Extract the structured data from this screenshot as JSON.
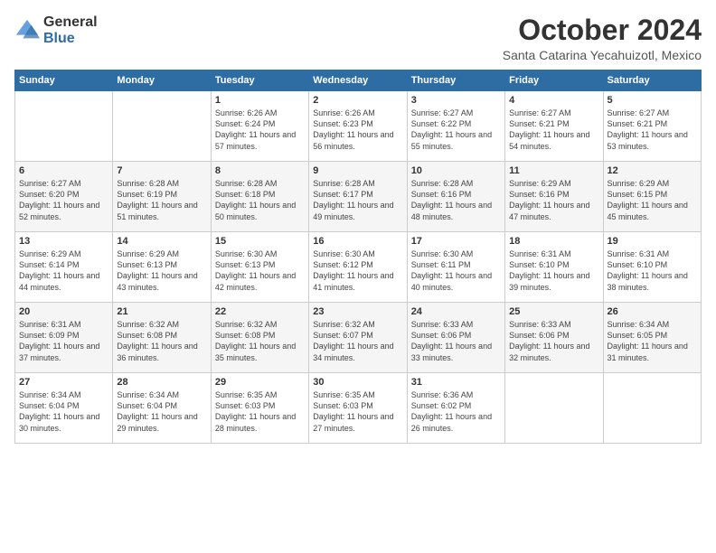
{
  "logo": {
    "general": "General",
    "blue": "Blue"
  },
  "header": {
    "month": "October 2024",
    "location": "Santa Catarina Yecahuizotl, Mexico"
  },
  "weekdays": [
    "Sunday",
    "Monday",
    "Tuesday",
    "Wednesday",
    "Thursday",
    "Friday",
    "Saturday"
  ],
  "weeks": [
    [
      {
        "day": "",
        "info": ""
      },
      {
        "day": "",
        "info": ""
      },
      {
        "day": "1",
        "info": "Sunrise: 6:26 AM\nSunset: 6:24 PM\nDaylight: 11 hours and 57 minutes."
      },
      {
        "day": "2",
        "info": "Sunrise: 6:26 AM\nSunset: 6:23 PM\nDaylight: 11 hours and 56 minutes."
      },
      {
        "day": "3",
        "info": "Sunrise: 6:27 AM\nSunset: 6:22 PM\nDaylight: 11 hours and 55 minutes."
      },
      {
        "day": "4",
        "info": "Sunrise: 6:27 AM\nSunset: 6:21 PM\nDaylight: 11 hours and 54 minutes."
      },
      {
        "day": "5",
        "info": "Sunrise: 6:27 AM\nSunset: 6:21 PM\nDaylight: 11 hours and 53 minutes."
      }
    ],
    [
      {
        "day": "6",
        "info": "Sunrise: 6:27 AM\nSunset: 6:20 PM\nDaylight: 11 hours and 52 minutes."
      },
      {
        "day": "7",
        "info": "Sunrise: 6:28 AM\nSunset: 6:19 PM\nDaylight: 11 hours and 51 minutes."
      },
      {
        "day": "8",
        "info": "Sunrise: 6:28 AM\nSunset: 6:18 PM\nDaylight: 11 hours and 50 minutes."
      },
      {
        "day": "9",
        "info": "Sunrise: 6:28 AM\nSunset: 6:17 PM\nDaylight: 11 hours and 49 minutes."
      },
      {
        "day": "10",
        "info": "Sunrise: 6:28 AM\nSunset: 6:16 PM\nDaylight: 11 hours and 48 minutes."
      },
      {
        "day": "11",
        "info": "Sunrise: 6:29 AM\nSunset: 6:16 PM\nDaylight: 11 hours and 47 minutes."
      },
      {
        "day": "12",
        "info": "Sunrise: 6:29 AM\nSunset: 6:15 PM\nDaylight: 11 hours and 45 minutes."
      }
    ],
    [
      {
        "day": "13",
        "info": "Sunrise: 6:29 AM\nSunset: 6:14 PM\nDaylight: 11 hours and 44 minutes."
      },
      {
        "day": "14",
        "info": "Sunrise: 6:29 AM\nSunset: 6:13 PM\nDaylight: 11 hours and 43 minutes."
      },
      {
        "day": "15",
        "info": "Sunrise: 6:30 AM\nSunset: 6:13 PM\nDaylight: 11 hours and 42 minutes."
      },
      {
        "day": "16",
        "info": "Sunrise: 6:30 AM\nSunset: 6:12 PM\nDaylight: 11 hours and 41 minutes."
      },
      {
        "day": "17",
        "info": "Sunrise: 6:30 AM\nSunset: 6:11 PM\nDaylight: 11 hours and 40 minutes."
      },
      {
        "day": "18",
        "info": "Sunrise: 6:31 AM\nSunset: 6:10 PM\nDaylight: 11 hours and 39 minutes."
      },
      {
        "day": "19",
        "info": "Sunrise: 6:31 AM\nSunset: 6:10 PM\nDaylight: 11 hours and 38 minutes."
      }
    ],
    [
      {
        "day": "20",
        "info": "Sunrise: 6:31 AM\nSunset: 6:09 PM\nDaylight: 11 hours and 37 minutes."
      },
      {
        "day": "21",
        "info": "Sunrise: 6:32 AM\nSunset: 6:08 PM\nDaylight: 11 hours and 36 minutes."
      },
      {
        "day": "22",
        "info": "Sunrise: 6:32 AM\nSunset: 6:08 PM\nDaylight: 11 hours and 35 minutes."
      },
      {
        "day": "23",
        "info": "Sunrise: 6:32 AM\nSunset: 6:07 PM\nDaylight: 11 hours and 34 minutes."
      },
      {
        "day": "24",
        "info": "Sunrise: 6:33 AM\nSunset: 6:06 PM\nDaylight: 11 hours and 33 minutes."
      },
      {
        "day": "25",
        "info": "Sunrise: 6:33 AM\nSunset: 6:06 PM\nDaylight: 11 hours and 32 minutes."
      },
      {
        "day": "26",
        "info": "Sunrise: 6:34 AM\nSunset: 6:05 PM\nDaylight: 11 hours and 31 minutes."
      }
    ],
    [
      {
        "day": "27",
        "info": "Sunrise: 6:34 AM\nSunset: 6:04 PM\nDaylight: 11 hours and 30 minutes."
      },
      {
        "day": "28",
        "info": "Sunrise: 6:34 AM\nSunset: 6:04 PM\nDaylight: 11 hours and 29 minutes."
      },
      {
        "day": "29",
        "info": "Sunrise: 6:35 AM\nSunset: 6:03 PM\nDaylight: 11 hours and 28 minutes."
      },
      {
        "day": "30",
        "info": "Sunrise: 6:35 AM\nSunset: 6:03 PM\nDaylight: 11 hours and 27 minutes."
      },
      {
        "day": "31",
        "info": "Sunrise: 6:36 AM\nSunset: 6:02 PM\nDaylight: 11 hours and 26 minutes."
      },
      {
        "day": "",
        "info": ""
      },
      {
        "day": "",
        "info": ""
      }
    ]
  ]
}
